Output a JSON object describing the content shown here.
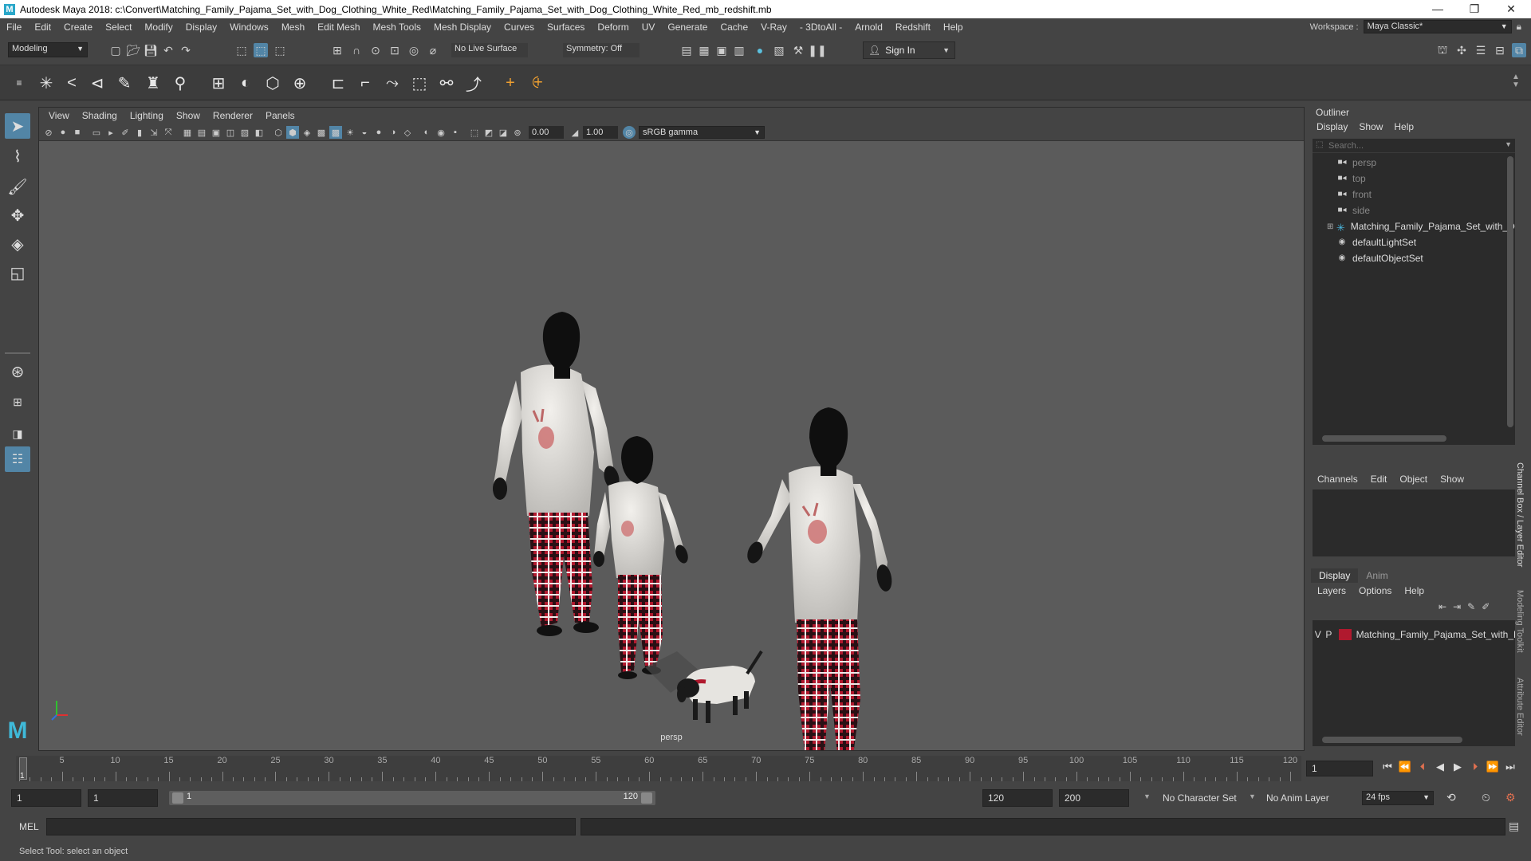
{
  "window": {
    "title": "Autodesk Maya 2018: c:\\Convert\\Matching_Family_Pajama_Set_with_Dog_Clothing_White_Red\\Matching_Family_Pajama_Set_with_Dog_Clothing_White_Red_mb_redshift.mb",
    "logo": "M"
  },
  "menubar": {
    "items": [
      "File",
      "Edit",
      "Create",
      "Select",
      "Modify",
      "Display",
      "Windows",
      "Mesh",
      "Edit Mesh",
      "Mesh Tools",
      "Mesh Display",
      "Curves",
      "Surfaces",
      "Deform",
      "UV",
      "Generate",
      "Cache",
      "V-Ray",
      "- 3DtoAll -",
      "Arnold",
      "Redshift",
      "Help"
    ],
    "workspace_label": "Workspace :",
    "workspace_value": "Maya Classic*"
  },
  "statusline": {
    "mode": "Modeling",
    "live_surface": "No Live Surface",
    "symmetry": "Symmetry: Off",
    "sign_in": "Sign In"
  },
  "viewport": {
    "menus": [
      "View",
      "Shading",
      "Lighting",
      "Show",
      "Renderer",
      "Panels"
    ],
    "exposure": "0.00",
    "gamma": "1.00",
    "color_space": "sRGB gamma",
    "camera_label": "persp"
  },
  "outliner": {
    "title": "Outliner",
    "menus": [
      "Display",
      "Show",
      "Help"
    ],
    "search_placeholder": "Search...",
    "items": [
      {
        "label": "persp",
        "type": "camera",
        "dim": true
      },
      {
        "label": "top",
        "type": "camera",
        "dim": true
      },
      {
        "label": "front",
        "type": "camera",
        "dim": true
      },
      {
        "label": "side",
        "type": "camera",
        "dim": true
      },
      {
        "label": "Matching_Family_Pajama_Set_with_Dog_",
        "type": "group",
        "dim": false
      },
      {
        "label": "defaultLightSet",
        "type": "set",
        "dim": false
      },
      {
        "label": "defaultObjectSet",
        "type": "set",
        "dim": false
      }
    ]
  },
  "channelbox": {
    "menus": [
      "Channels",
      "Edit",
      "Object",
      "Show"
    ]
  },
  "layereditor": {
    "tabs": [
      "Display",
      "Anim"
    ],
    "menus": [
      "Layers",
      "Options",
      "Help"
    ],
    "layer": {
      "v": "V",
      "p": "P",
      "name": "Matching_Family_Pajama_Set_with_D",
      "color": "#b0192e"
    }
  },
  "sidetabs": [
    "Channel Box / Layer Editor",
    "Modeling Toolkit",
    "Attribute Editor"
  ],
  "timeslider": {
    "labels": [
      "5",
      "10",
      "15",
      "20",
      "25",
      "30",
      "35",
      "40",
      "45",
      "50",
      "55",
      "60",
      "65",
      "70",
      "75",
      "80",
      "85",
      "90",
      "95",
      "100",
      "105",
      "110",
      "115",
      "120"
    ],
    "current_start": "1",
    "current_frame": "1"
  },
  "rangeslider": {
    "start": "1",
    "playback_start": "1",
    "range_start": "1",
    "range_end": "120",
    "playback_end": "120",
    "end": "200",
    "character_set": "No Character Set",
    "anim_layer": "No Anim Layer",
    "fps": "24 fps"
  },
  "cmdline": {
    "lang": "MEL"
  },
  "helpline": {
    "text": "Select Tool: select an object"
  },
  "colors": {
    "pajama_red": "#b0192e",
    "shirt_white": "#e8e6e2",
    "body_black": "#111111",
    "viewport_bg": "#5b5b5b"
  }
}
